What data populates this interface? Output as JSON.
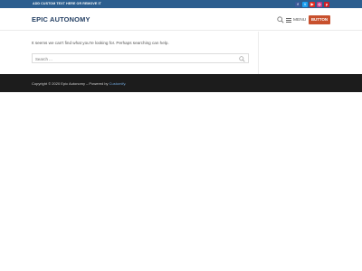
{
  "topbar": {
    "text": "ADD CUSTOM TEXT HERE OR REMOVE IT",
    "social": [
      {
        "icon": "facebook-icon",
        "glyph": "f",
        "color": "#3b5998"
      },
      {
        "icon": "twitter-icon",
        "glyph": "t",
        "color": "#1da1f2"
      },
      {
        "icon": "youtube-icon",
        "glyph": "▶",
        "color": "#e02a20"
      },
      {
        "icon": "instagram-icon",
        "glyph": "◎",
        "color": "#c13584"
      },
      {
        "icon": "pinterest-icon",
        "glyph": "p",
        "color": "#cb2027"
      }
    ]
  },
  "header": {
    "logo": "EPIC AUTONOMY",
    "menu_label": "MENU",
    "button_label": "BUTTON"
  },
  "main": {
    "message": "It seems we can't find what you're looking for. Perhaps searching can help.",
    "search_placeholder": "Search ..."
  },
  "footer": {
    "copyright": "Copyright © 2020 Epic Autonomy",
    "separator": " – Powered by ",
    "powered_by": "Customify",
    "suffix": "."
  },
  "colors": {
    "topbar": "#2c5e8f",
    "accent": "#c8502d",
    "footer": "#1c1c1c"
  }
}
